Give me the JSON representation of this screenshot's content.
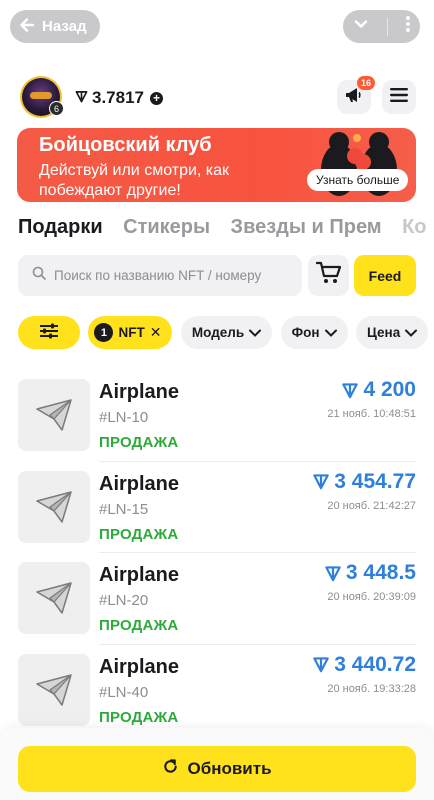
{
  "topbar": {
    "back_label": "Назад"
  },
  "profile": {
    "level": "6",
    "balance": "3.7817",
    "notifications_count": "16"
  },
  "banner": {
    "title": "Бойцовский клуб",
    "text": "Действуй или смотри, как побеждают другие!",
    "button_label": "Узнать больше"
  },
  "tabs": [
    {
      "label": "Подарки",
      "active": true
    },
    {
      "label": "Стикеры",
      "active": false
    },
    {
      "label": "Звезды и Прем",
      "active": false
    },
    {
      "label": "Ко",
      "active": false
    }
  ],
  "search": {
    "placeholder": "Поиск по названию NFT / номеру",
    "feed_label": "Feed"
  },
  "filters": {
    "nft_count": "1",
    "nft_label": "NFT",
    "model_label": "Модель",
    "background_label": "Фон",
    "price_label": "Цена"
  },
  "items": [
    {
      "name": "Airplane",
      "number": "#LN-10",
      "status": "ПРОДАЖА",
      "price": "4 200",
      "date": "21 нояб. 10:48:51"
    },
    {
      "name": "Airplane",
      "number": "#LN-15",
      "status": "ПРОДАЖА",
      "price": "3 454.77",
      "date": "20 нояб. 21:42:27"
    },
    {
      "name": "Airplane",
      "number": "#LN-20",
      "status": "ПРОДАЖА",
      "price": "3 448.5",
      "date": "20 нояб. 20:39:09"
    },
    {
      "name": "Airplane",
      "number": "#LN-40",
      "status": "ПРОДАЖА",
      "price": "3 440.72",
      "date": "20 нояб. 19:33:28"
    }
  ],
  "bottom": {
    "refresh_label": "Обновить"
  },
  "colors": {
    "accent_yellow": "#ffe11c",
    "price_blue": "#2f7fdb",
    "status_green": "#2eaa3c",
    "banner_red": "#f8533f"
  }
}
